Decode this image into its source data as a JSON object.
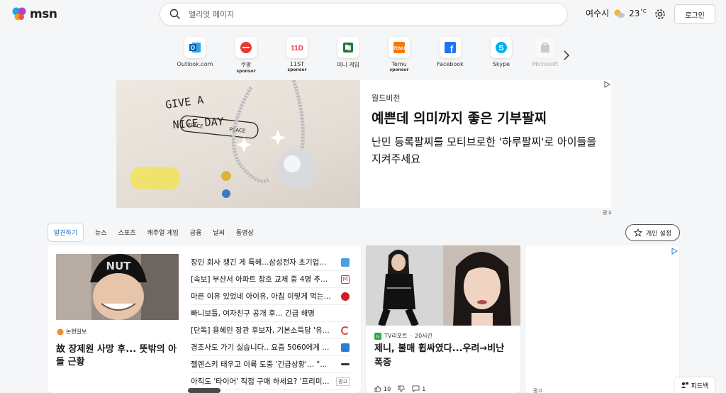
{
  "header": {
    "logo_text": "msn",
    "search_placeholder": "엘리엇 페이지",
    "weather": {
      "location": "여수시",
      "temp": "23",
      "unit": "°C"
    },
    "login_label": "로그인"
  },
  "quick_links": [
    {
      "label": "Outlook.com",
      "icon": "outlook-icon",
      "sponsor": ""
    },
    {
      "label": "쿠팡",
      "icon": "coupang-icon",
      "sponsor": "sponsor"
    },
    {
      "label": "11ST",
      "icon": "11st-icon",
      "sponsor": "sponsor"
    },
    {
      "label": "미니 게임",
      "icon": "mini-game-icon",
      "sponsor": ""
    },
    {
      "label": "Temu",
      "icon": "temu-icon",
      "sponsor": "sponsor"
    },
    {
      "label": "Facebook",
      "icon": "facebook-icon",
      "sponsor": ""
    },
    {
      "label": "Skype",
      "icon": "skype-icon",
      "sponsor": ""
    },
    {
      "label": "Microsoft",
      "icon": "microsoft-store-icon",
      "sponsor": ""
    }
  ],
  "ad_banner": {
    "image_text": {
      "line1": "GIVE A",
      "line2": "NICE DAY",
      "word": "PEACE"
    },
    "source": "월드비전",
    "title": "예쁜데 의미까지 좋은 기부팔찌",
    "description": "난민 등록팔찌를 모티브로한 '하루팔찌'로 아이들을 지켜주세요",
    "ad_label": "광고"
  },
  "tabs": [
    "발견하기",
    "뉴스",
    "스포츠",
    "캐주얼 게임",
    "금융",
    "날씨",
    "동영상"
  ],
  "personal_settings_label": "개인 설정",
  "card_main": {
    "source": "논현일보",
    "headline": "故 장제원 사망 후... 뜻밖의 아들 근황",
    "cap_text": "NUT",
    "list": [
      {
        "text": "장인 회사 챙긴 게 특혜...삼성전자 초기업...",
        "badge_color": "#4aa3df"
      },
      {
        "text": "[속보] 부산서 아파트 창호 교체 중 4명 추...",
        "badge_color": "#d9382e"
      },
      {
        "text": "마른 이유 있었네 아이유, 아침 이렇게 먹는...",
        "badge_color": "#c7202a"
      },
      {
        "text": "빠니보틀, 여자친구 공개 후... 긴급 해명",
        "badge_color": ""
      },
      {
        "text": "[단독] 용혜인 장관 후보자, 기본소득당 '유...",
        "badge_color": "#e0463c"
      },
      {
        "text": "경조사도 가기 싫습니다.. 요즘 5060에게 ...",
        "badge_color": "#2a7fd4"
      },
      {
        "text": "젤렌스키 태우고 이륙 도중 '긴급상황'... \"...",
        "badge_color": "#333333"
      },
      {
        "text": "아직도 '타이어' 직접 구매 하세요? '프리미...",
        "badge_color": "",
        "tag": "광고"
      }
    ]
  },
  "card_second": {
    "source": "TV리포트",
    "time": "20시간",
    "headline": "제니, 불매 휩싸였다...우려→비난 폭증",
    "likes": "10",
    "comments": "1"
  },
  "card_ad": {
    "ad_label": "광고"
  },
  "feedback_label": "피드백"
}
